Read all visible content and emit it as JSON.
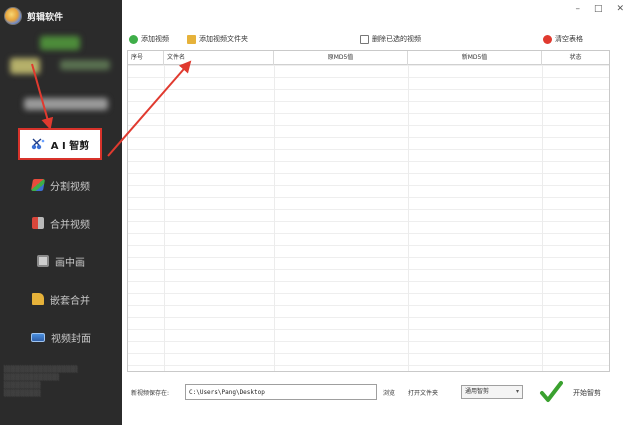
{
  "app": {
    "title": "剪辑软件"
  },
  "window_controls": {
    "minimize": "–",
    "maximize": "□",
    "close": "✕"
  },
  "sidebar": {
    "active_item": {
      "label": "A I 智剪",
      "icon": "ai-scissors-icon"
    },
    "items": [
      {
        "label": "分割视频",
        "icon": "split-icon"
      },
      {
        "label": "合并视频",
        "icon": "merge-icon"
      },
      {
        "label": "画中画",
        "icon": "pip-icon"
      },
      {
        "label": "嵌套合并",
        "icon": "nest-icon"
      },
      {
        "label": "视频封面",
        "icon": "cover-icon"
      }
    ]
  },
  "toolbar": {
    "add_video": "添加视频",
    "add_folder": "添加视频文件夹",
    "delete_selected": "删除已选的视频",
    "clear_table": "清空表格"
  },
  "table": {
    "columns": [
      "序号",
      "文件名",
      "原MD5值",
      "新MD5值",
      "状态"
    ],
    "rows": []
  },
  "bottom": {
    "save_label": "新视频保存在:",
    "save_path": "C:\\Users\\Pang\\Desktop",
    "browse": "浏览",
    "open_folder": "打开文件夹",
    "mode": "通用智剪",
    "start": "开始智剪"
  },
  "colors": {
    "sidebar_bg": "#2b2b2b",
    "highlight_border": "#d8332b",
    "check_green": "#3aa12f",
    "arrow_red": "#e03a2f"
  }
}
